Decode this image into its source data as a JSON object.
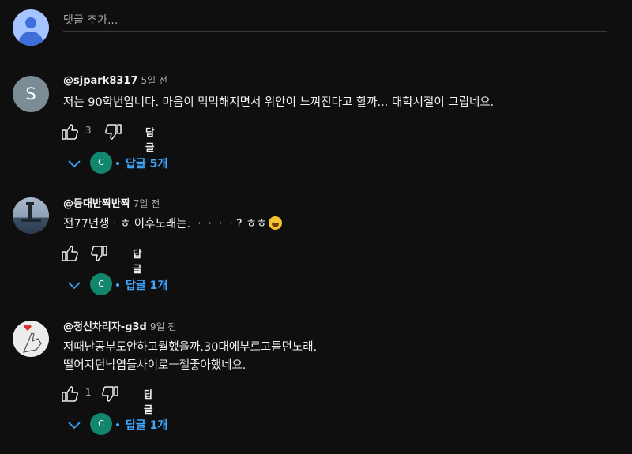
{
  "add_comment": {
    "placeholder": "댓글 추가..."
  },
  "comments": [
    {
      "author": "@sjpark8317",
      "time": "5일 전",
      "avatar_letter": "S",
      "lines": [
        "저는 90학번입니다. 마음이 먹먹해지면서 위안이 느껴진다고 할까... 대학시절이 그립네요."
      ],
      "likes": "3",
      "reply_label": "답글",
      "reply_avatar_letter": "C",
      "replies_label": "답글 5개"
    },
    {
      "author": "@등대반짝반짝",
      "time": "7일 전",
      "lines": [
        "전77년생ㆍㅎ 이후노래는.  ㆍㆍㆍㆍ? ㅎㅎ"
      ],
      "likes": "",
      "reply_label": "답글",
      "reply_avatar_letter": "C",
      "replies_label": "답글 1개"
    },
    {
      "author": "@정신차리자-g3d",
      "time": "9일 전",
      "lines": [
        "저때난공부도안하고뭘했을까.30대에부르고듣던노래.",
        "떨어지던낙엽들사이로ㅡ젤좋아했네요."
      ],
      "likes": "1",
      "reply_label": "답글",
      "reply_avatar_letter": "C",
      "replies_label": "답글 1개"
    }
  ],
  "colors": {
    "background": "#0f0f0f",
    "link": "#3ea6ff",
    "reply_avatar": "#13866e"
  },
  "icons": [
    "account-icon",
    "thumbs-up-icon",
    "thumbs-down-icon",
    "chevron-down-icon",
    "laughing-emoji-icon"
  ]
}
